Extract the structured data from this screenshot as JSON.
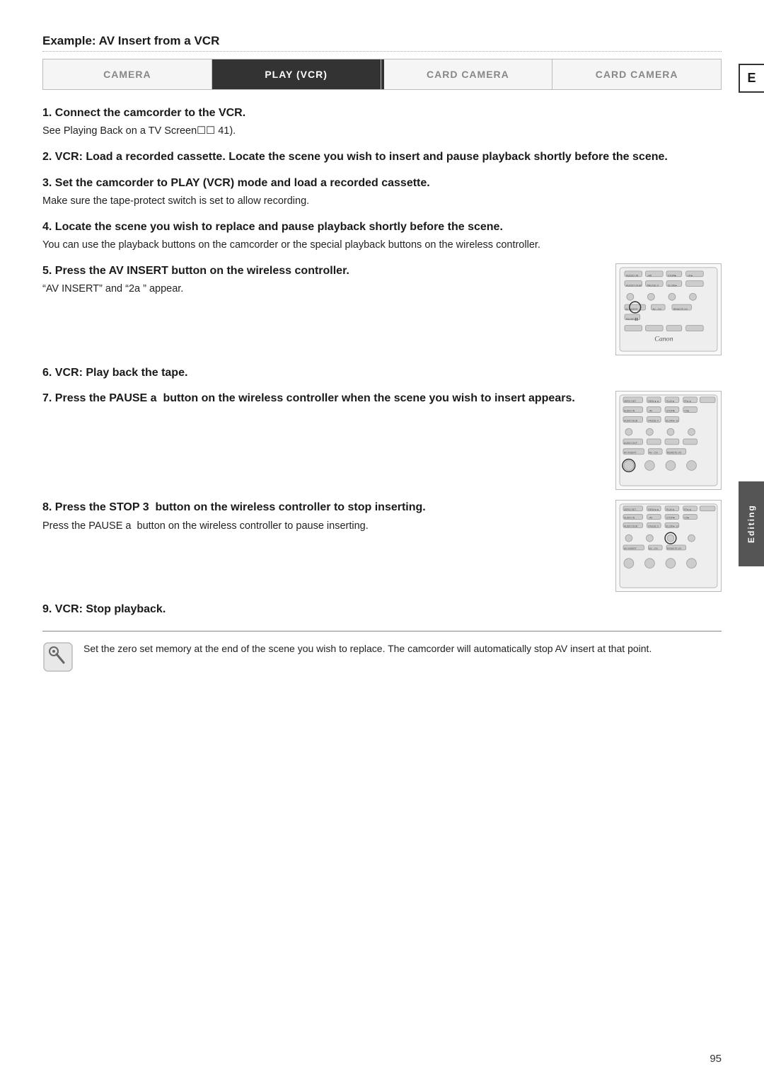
{
  "title": "Example: AV Insert from a VCR",
  "mode_bar": {
    "cells": [
      {
        "label": "CAMERA",
        "active": false
      },
      {
        "label": "PLAY (VCR)",
        "active": true
      },
      {
        "label": "CARD CAMERA",
        "active": false
      },
      {
        "label": "CARD CAMERA",
        "active": false
      }
    ]
  },
  "steps": [
    {
      "id": 1,
      "heading": "1. Connect the camcorder to the VCR.",
      "body": "See Playing Back on a TV Screen   41).",
      "has_image": false
    },
    {
      "id": 2,
      "heading": "2. VCR: Load a recorded cassette. Locate the scene you wish to insert and pause playback shortly before the scene.",
      "body": "",
      "has_image": false
    },
    {
      "id": 3,
      "heading": "3. Set the camcorder to PLAY (VCR) mode and load a recorded cassette.",
      "body": "Make sure the tape-protect switch is set to allow recording.",
      "has_image": false
    },
    {
      "id": 4,
      "heading": "4. Locate the scene you wish to replace and pause playback shortly before the scene.",
      "body": "You can use the playback buttons on the camcorder or the special playback buttons on the wireless controller.",
      "has_image": false
    },
    {
      "id": 5,
      "heading": "5. Press the AV INSERT button on the wireless controller.",
      "body": "“AV INSERT” and “2a ” appear.",
      "has_image": true,
      "image_index": 0
    },
    {
      "id": 6,
      "heading": "6. VCR: Play back the tape.",
      "body": "",
      "has_image": false
    },
    {
      "id": 7,
      "heading": "7. Press the PAUSE a  button on the wireless controller when the scene you wish to insert appears.",
      "body": "",
      "has_image": true,
      "image_index": 1
    },
    {
      "id": 8,
      "heading": "8. Press the STOP 3  button on the wireless controller to stop inserting.",
      "body": "Press the PAUSE a  button on the wireless controller to pause inserting.",
      "has_image": true,
      "image_index": 2
    },
    {
      "id": 9,
      "heading": "9. VCR: Stop playback.",
      "body": "",
      "has_image": false
    }
  ],
  "note": {
    "text": "Set the zero set memory at the end of the scene you wish to replace. The camcorder will automatically stop AV insert at that point."
  },
  "side_tab_e": "E",
  "side_tab_editing": "Editing",
  "page_number": "95"
}
